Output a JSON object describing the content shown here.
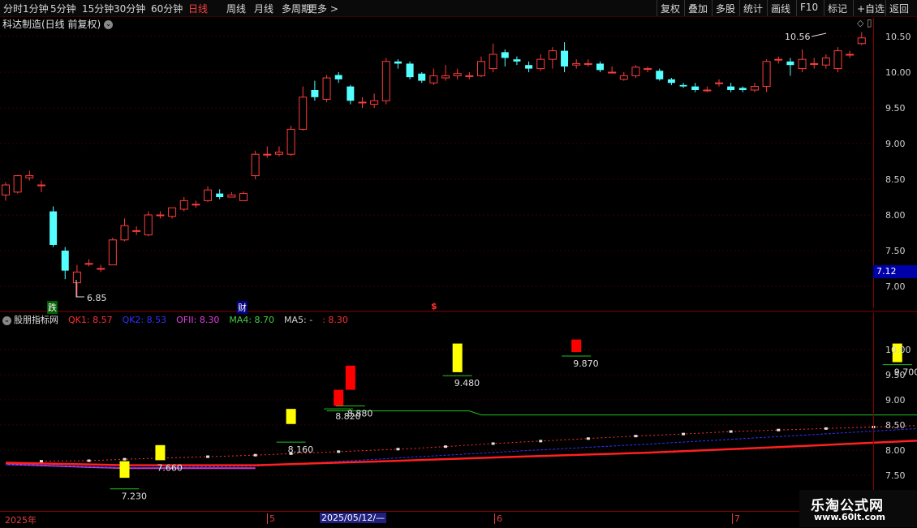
{
  "toolbar": {
    "left_items": [
      "分时",
      "1分钟",
      "5分钟",
      "15分钟",
      "30分钟",
      "60分钟",
      "日线",
      "周线",
      "月线",
      "多周期",
      "更多 >"
    ],
    "active": "日线",
    "right_items": [
      "复权",
      "叠加",
      "多股",
      "统计",
      "画线",
      "F10",
      "标记",
      "+自选",
      "返回"
    ]
  },
  "stock": {
    "title": "科达制造(日线 前复权)",
    "dropdown": "⌄"
  },
  "markers": {
    "limit_down": "跌",
    "finance": "财",
    "dollar": "$"
  },
  "price_annotations": {
    "high": "10.56",
    "low": "6.85"
  },
  "price_axis": {
    "ticks": [
      "10.50",
      "10.00",
      "9.50",
      "9.00",
      "8.50",
      "8.00",
      "7.50",
      "7.00"
    ],
    "last_price": "7.12",
    "diamond": "◇",
    "scroll": "▯"
  },
  "indicator": {
    "name": "股朋指标网",
    "values": [
      {
        "label": "QK1: 8.57",
        "color": "#ff3030"
      },
      {
        "label": "QK2: 8.53",
        "color": "#3030ff"
      },
      {
        "label": "OFII: 8.30",
        "color": "#e040e0"
      },
      {
        "label": "MA4: 8.70",
        "color": "#40d040"
      },
      {
        "label": "MA5: -",
        "color": "#d0d0d0"
      },
      {
        "label": ": 8.30",
        "color": "#ff3030"
      }
    ],
    "axis_ticks": [
      "10.00",
      "9.50",
      "9.00",
      "8.50",
      "8.00",
      "7.50"
    ],
    "box_labels": [
      "7.230",
      "7.660",
      "8.160",
      "8.820",
      "8.880",
      "9.480",
      "9.870",
      "9.700"
    ]
  },
  "date_axis": {
    "labels": [
      "2025年",
      "5",
      "2025/05/12/—",
      "6",
      "7"
    ]
  },
  "watermark": {
    "title": "乐淘公式网",
    "url": "www.60lt.com"
  },
  "chart_data": {
    "type": "candlestick",
    "ylim": [
      6.75,
      10.75
    ],
    "candles": [
      [
        8.28,
        8.42,
        8.46,
        8.2
      ],
      [
        8.32,
        8.55,
        8.56,
        8.3
      ],
      [
        8.52,
        8.55,
        8.62,
        8.48
      ],
      [
        8.42,
        8.42,
        8.48,
        8.32
      ],
      [
        8.05,
        7.58,
        8.12,
        7.55
      ],
      [
        7.5,
        7.22,
        7.55,
        7.1
      ],
      [
        7.05,
        7.2,
        7.3,
        6.85
      ],
      [
        7.32,
        7.32,
        7.38,
        7.28
      ],
      [
        7.25,
        7.25,
        7.3,
        7.2
      ],
      [
        7.3,
        7.65,
        7.68,
        7.3
      ],
      [
        7.65,
        7.85,
        7.95,
        7.63
      ],
      [
        7.78,
        7.78,
        7.84,
        7.72
      ],
      [
        7.72,
        8.0,
        8.05,
        7.7
      ],
      [
        8.0,
        8.0,
        8.05,
        7.95
      ],
      [
        7.98,
        8.1,
        8.1,
        7.95
      ],
      [
        8.08,
        8.2,
        8.25,
        8.05
      ],
      [
        8.15,
        8.15,
        8.2,
        8.1
      ],
      [
        8.2,
        8.35,
        8.4,
        8.18
      ],
      [
        8.3,
        8.25,
        8.36,
        8.22
      ],
      [
        8.25,
        8.28,
        8.32,
        8.25
      ],
      [
        8.2,
        8.3,
        8.33,
        8.2
      ],
      [
        8.55,
        8.85,
        8.9,
        8.5
      ],
      [
        8.85,
        8.85,
        8.96,
        8.8
      ],
      [
        8.85,
        8.88,
        8.96,
        8.82
      ],
      [
        8.85,
        9.2,
        9.25,
        8.83
      ],
      [
        9.2,
        9.65,
        9.8,
        9.18
      ],
      [
        9.75,
        9.65,
        9.88,
        9.6
      ],
      [
        9.62,
        9.92,
        9.96,
        9.58
      ],
      [
        9.96,
        9.9,
        10.0,
        9.85
      ],
      [
        9.8,
        9.6,
        9.82,
        9.55
      ],
      [
        9.58,
        9.58,
        9.65,
        9.5
      ],
      [
        9.55,
        9.6,
        9.7,
        9.5
      ],
      [
        9.6,
        10.15,
        10.2,
        9.55
      ],
      [
        10.15,
        10.12,
        10.18,
        10.05
      ],
      [
        10.12,
        9.93,
        10.15,
        9.9
      ],
      [
        9.98,
        9.88,
        10.0,
        9.85
      ],
      [
        9.85,
        9.95,
        10.05,
        9.82
      ],
      [
        9.92,
        9.95,
        10.1,
        9.88
      ],
      [
        9.95,
        9.98,
        10.05,
        9.9
      ],
      [
        9.95,
        9.95,
        10.0,
        9.9
      ],
      [
        9.95,
        10.15,
        10.22,
        9.93
      ],
      [
        10.05,
        10.25,
        10.4,
        10.0
      ],
      [
        10.28,
        10.2,
        10.32,
        10.08
      ],
      [
        10.18,
        10.15,
        10.22,
        10.1
      ],
      [
        10.1,
        10.05,
        10.15,
        10.0
      ],
      [
        10.05,
        10.18,
        10.25,
        10.02
      ],
      [
        10.18,
        10.3,
        10.35,
        10.05
      ],
      [
        10.3,
        10.08,
        10.42,
        10.0
      ],
      [
        10.1,
        10.12,
        10.18,
        10.05
      ],
      [
        10.12,
        10.12,
        10.18,
        10.08
      ],
      [
        10.12,
        10.03,
        10.15,
        10.0
      ],
      [
        10.0,
        10.0,
        10.08,
        9.98
      ],
      [
        9.9,
        9.95,
        10.0,
        9.88
      ],
      [
        9.95,
        10.07,
        10.1,
        9.92
      ],
      [
        10.05,
        10.05,
        10.08,
        10.0
      ],
      [
        10.02,
        9.9,
        10.05,
        9.88
      ],
      [
        9.9,
        9.85,
        9.92,
        9.82
      ],
      [
        9.82,
        9.8,
        9.85,
        9.78
      ],
      [
        9.8,
        9.75,
        9.85,
        9.72
      ],
      [
        9.75,
        9.75,
        9.8,
        9.72
      ],
      [
        9.85,
        9.85,
        9.9,
        9.8
      ],
      [
        9.8,
        9.75,
        9.85,
        9.72
      ],
      [
        9.78,
        9.75,
        9.8,
        9.72
      ],
      [
        9.75,
        9.8,
        9.85,
        9.72
      ],
      [
        9.8,
        10.15,
        10.18,
        9.72
      ],
      [
        10.18,
        10.18,
        10.22,
        10.12
      ],
      [
        10.15,
        10.1,
        10.2,
        9.95
      ],
      [
        10.05,
        10.18,
        10.32,
        10.0
      ],
      [
        10.12,
        10.12,
        10.2,
        10.05
      ],
      [
        10.1,
        10.2,
        10.25,
        10.05
      ],
      [
        10.05,
        10.3,
        10.35,
        10.0
      ],
      [
        10.25,
        10.25,
        10.3,
        10.2
      ],
      [
        10.4,
        10.48,
        10.56,
        10.38
      ]
    ],
    "ind_ylim": [
      7.25,
      10.6
    ],
    "qk1": [
      [
        0,
        7.75
      ],
      [
        10,
        7.7
      ],
      [
        21,
        7.7
      ],
      [
        32,
        7.78
      ],
      [
        43,
        7.87
      ],
      [
        54,
        7.95
      ],
      [
        65,
        8.06
      ],
      [
        76,
        8.18
      ],
      [
        86,
        8.28
      ]
    ],
    "qk2": [
      [
        0,
        7.72
      ],
      [
        10,
        7.65
      ],
      [
        21,
        7.68
      ],
      [
        32,
        7.83
      ],
      [
        43,
        7.98
      ],
      [
        54,
        8.12
      ],
      [
        65,
        8.27
      ],
      [
        76,
        8.42
      ],
      [
        86,
        8.56
      ]
    ],
    "ofii": [
      [
        0,
        7.72
      ],
      [
        10,
        7.64
      ],
      [
        21,
        7.64
      ]
    ],
    "ma4": [
      [
        27,
        8.78
      ],
      [
        28,
        8.78
      ],
      [
        39,
        8.78
      ],
      [
        40,
        8.7
      ],
      [
        86,
        8.7
      ]
    ],
    "dots": [
      [
        3,
        7.78
      ],
      [
        7,
        7.79
      ],
      [
        10,
        7.82
      ],
      [
        13,
        7.84
      ],
      [
        17,
        7.87
      ],
      [
        21,
        7.9
      ],
      [
        24,
        7.93
      ],
      [
        28,
        7.97
      ],
      [
        33,
        8.02
      ],
      [
        37,
        8.07
      ],
      [
        41,
        8.13
      ],
      [
        45,
        8.18
      ],
      [
        49,
        8.23
      ],
      [
        53,
        8.28
      ],
      [
        57,
        8.32
      ],
      [
        61,
        8.37
      ],
      [
        65,
        8.4
      ],
      [
        69,
        8.43
      ],
      [
        73,
        8.46
      ],
      [
        77,
        8.49
      ],
      [
        81,
        8.52
      ],
      [
        85,
        8.58
      ]
    ],
    "boxes": [
      {
        "i": 10,
        "bottom": 7.45,
        "top": 7.78,
        "color": "#ffff00",
        "label": "7.230",
        "line": 7.23
      },
      {
        "i": 13,
        "bottom": 7.8,
        "top": 8.1,
        "color": "#ffff00",
        "label": "7.660",
        "line": null
      },
      {
        "i": 24,
        "bottom": 8.52,
        "top": 8.82,
        "color": "#ffff00",
        "label": "8.160",
        "line": 8.16
      },
      {
        "i": 28,
        "bottom": 8.88,
        "top": 9.2,
        "color": "#ff0000",
        "label": "8.820",
        "line": 8.82
      },
      {
        "i": 29,
        "bottom": 9.2,
        "top": 9.68,
        "color": "#ff0000",
        "label": "8.880",
        "line": 8.88
      },
      {
        "i": 38,
        "bottom": 9.55,
        "top": 10.12,
        "color": "#ffff00",
        "label": "9.480",
        "line": 9.48
      },
      {
        "i": 48,
        "bottom": 9.95,
        "top": 10.2,
        "color": "#ff0000",
        "label": "9.870",
        "line": 9.87
      },
      {
        "i": 75,
        "bottom": 9.75,
        "top": 10.12,
        "color": "#ffff00",
        "label": "9.700",
        "line": 9.7
      }
    ]
  }
}
